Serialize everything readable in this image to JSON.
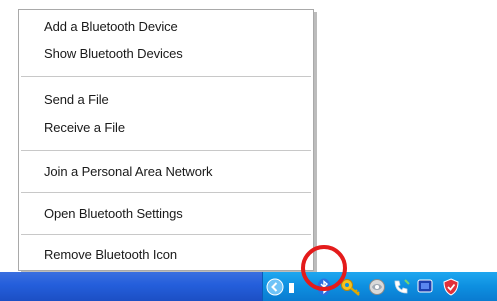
{
  "context_menu": {
    "items": [
      {
        "label": "Add a Bluetooth Device"
      },
      {
        "label": "Show Bluetooth Devices"
      },
      {
        "label": "Send a File"
      },
      {
        "label": "Receive a File"
      },
      {
        "label": "Join a Personal Area Network"
      },
      {
        "label": "Open Bluetooth Settings"
      },
      {
        "label": "Remove Bluetooth Icon"
      }
    ]
  },
  "tray": {
    "icons": [
      "chevron-left-icon",
      "bluetooth-icon",
      "key-icon",
      "network-globe-icon",
      "phone-icon",
      "monitor-icon",
      "shield-icon"
    ],
    "highlight_color": "#e41b1b"
  },
  "colors": {
    "taskbar": "#245edb",
    "tray": "#0d8fe0"
  }
}
